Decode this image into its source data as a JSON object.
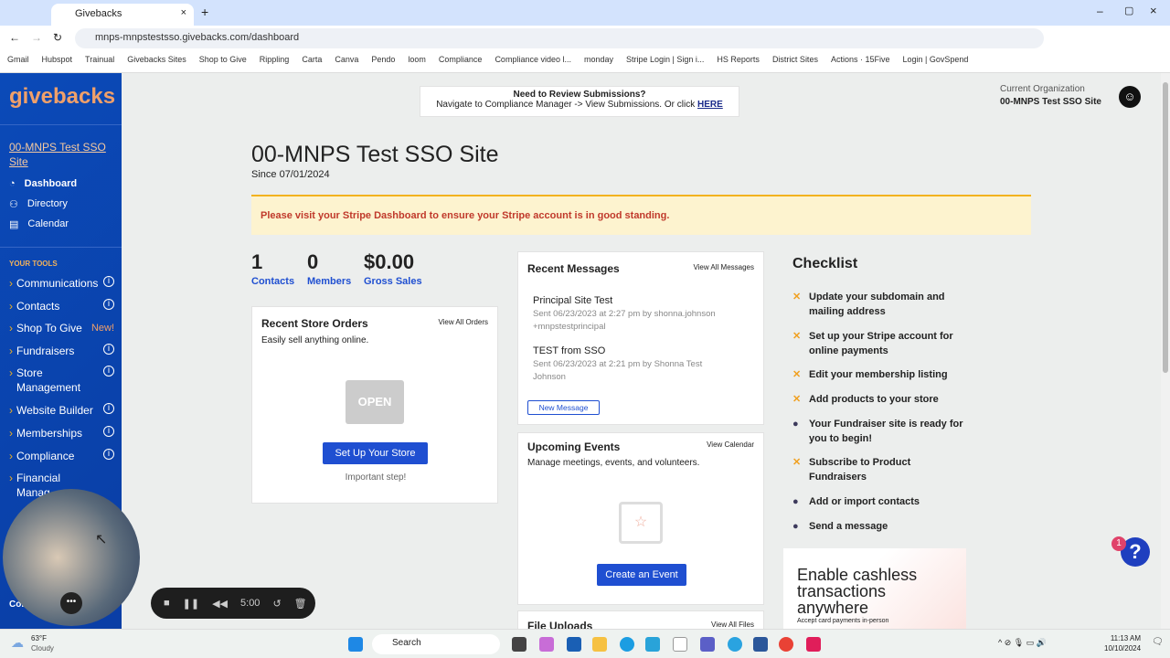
{
  "browser": {
    "tab_title": "Givebacks",
    "url": "mnps-mnpstestsso.givebacks.com/dashboard",
    "bookmarks": [
      "Gmail",
      "Hubspot",
      "Trainual",
      "Givebacks Sites",
      "Shop to Give",
      "Rippling",
      "Carta",
      "Canva",
      "Pendo",
      "loom",
      "Compliance",
      "Compliance video l...",
      "monday",
      "Stripe Login | Sign i...",
      "HS Reports",
      "District Sites",
      "Actions · 15Five",
      "Login | GovSpend"
    ]
  },
  "sidebar": {
    "logo": "givebacks",
    "site_link": "00-MNPS Test SSO Site",
    "nav": [
      {
        "label": "Dashboard"
      },
      {
        "label": "Directory"
      },
      {
        "label": "Calendar"
      }
    ],
    "tools_header": "YOUR TOOLS",
    "tools": [
      {
        "label": "Communications"
      },
      {
        "label": "Contacts"
      },
      {
        "label": "Shop To Give",
        "badge": "New!"
      },
      {
        "label": "Fundraisers"
      },
      {
        "label": "Store Management"
      },
      {
        "label": "Website Builder"
      },
      {
        "label": "Memberships"
      },
      {
        "label": "Compliance"
      },
      {
        "label": "Financial Manag..."
      }
    ],
    "bottom_partial": "Con..."
  },
  "notice": {
    "title": "Need to Review Submissions?",
    "text": "Navigate to Compliance Manager -> View Submissions.  Or click ",
    "link": "HERE"
  },
  "org": {
    "label": "Current Organization",
    "name": "00-MNPS Test SSO Site"
  },
  "page": {
    "title": "00-MNPS Test SSO Site",
    "since": "Since 07/01/2024",
    "alert": "Please visit your Stripe Dashboard to ensure your Stripe account is in good standing."
  },
  "stats": [
    {
      "value": "1",
      "label": "Contacts"
    },
    {
      "value": "0",
      "label": "Members"
    },
    {
      "value": "$0.00",
      "label": "Gross Sales"
    }
  ],
  "store": {
    "title": "Recent Store Orders",
    "link": "View All Orders",
    "subtitle": "Easily sell anything online.",
    "sign": "OPEN",
    "button": "Set Up Your Store",
    "note": "Important step!"
  },
  "messages": {
    "title": "Recent Messages",
    "link": "View All Messages",
    "items": [
      {
        "subject": "Principal Site Test",
        "meta": "Sent 06/23/2023 at 2:27 pm by shonna.johnson+mnpstestprincipal"
      },
      {
        "subject": "TEST from SSO",
        "meta": "Sent 06/23/2023 at 2:21 pm by Shonna Test Johnson"
      }
    ],
    "button": "New Message"
  },
  "events": {
    "title": "Upcoming Events",
    "link": "View Calendar",
    "subtitle": "Manage meetings, events, and volunteers.",
    "button": "Create an Event"
  },
  "files": {
    "title": "File Uploads",
    "link": "View All Files"
  },
  "checklist": {
    "title": "Checklist",
    "items": [
      {
        "text": "Update your subdomain and mailing address",
        "done": false
      },
      {
        "text": "Set up your Stripe account for online payments",
        "done": false
      },
      {
        "text": "Edit your membership listing",
        "done": false
      },
      {
        "text": "Add products to your store",
        "done": false
      },
      {
        "text": "Your Fundraiser site is ready for you to begin!",
        "done": true
      },
      {
        "text": "Subscribe to Product Fundraisers",
        "done": false
      },
      {
        "text": "Add or import contacts",
        "done": true
      },
      {
        "text": "Send a message",
        "done": true
      }
    ]
  },
  "promo": {
    "title": "Enable cashless transactions anywhere",
    "sub": "Accept card payments in-person"
  },
  "help": {
    "badge": "1",
    "icon": "?"
  },
  "recorder": {
    "time": "5:00"
  },
  "taskbar": {
    "weather_temp": "63°F",
    "weather": "Cloudy",
    "search": "Search",
    "time": "11:13 AM",
    "date": "10/10/2024"
  }
}
